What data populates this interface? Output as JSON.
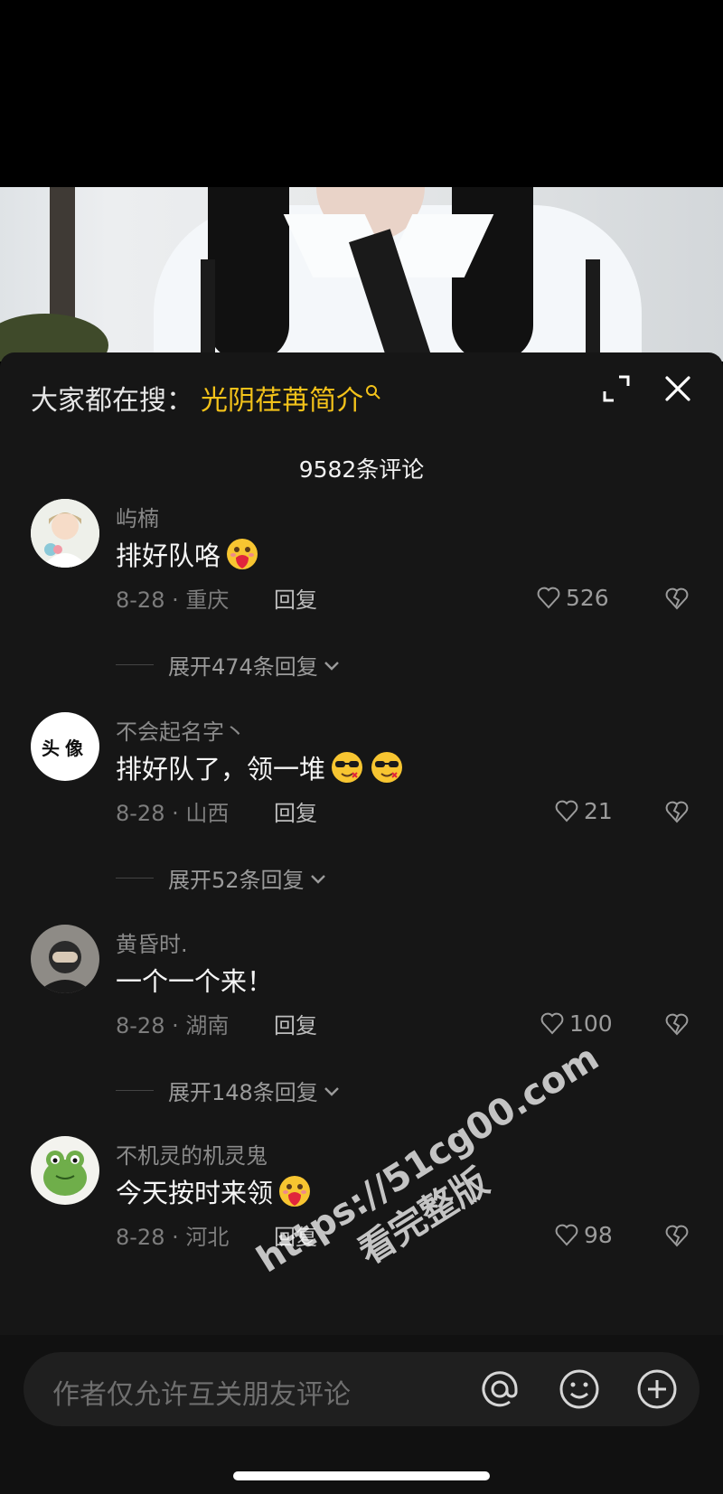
{
  "search_bar": {
    "prefix": "大家都在搜：",
    "term": "光阴荏苒简介"
  },
  "comment_count": "9582条评论",
  "comments": [
    {
      "username": "屿楠",
      "text": "排好队咯",
      "date_location": "8-28 · 重庆",
      "reply": "回复",
      "likes": "526",
      "expand": "展开474条回复"
    },
    {
      "username": "不会起名字丶",
      "text": "排好队了，领一堆",
      "date_location": "8-28 · 山西",
      "reply": "回复",
      "likes": "21",
      "expand": "展开52条回复",
      "avatar_text_1": "头",
      "avatar_text_2": "像"
    },
    {
      "username": "黄昏时.",
      "text": "一个一个来！",
      "date_location": "8-28 · 湖南",
      "reply": "回复",
      "likes": "100",
      "expand": "展开148条回复"
    },
    {
      "username": "不机灵的机灵鬼",
      "text": "今天按时来领",
      "date_location": "8-28 · 河北",
      "reply": "回复",
      "likes": "98"
    }
  ],
  "input": {
    "placeholder": "作者仅允许互关朋友评论"
  },
  "watermark": {
    "line1": "https://51cg00.com",
    "line2": "看完整版"
  },
  "colors": {
    "accent": "#f3c21a",
    "sheet_bg": "#161616"
  }
}
